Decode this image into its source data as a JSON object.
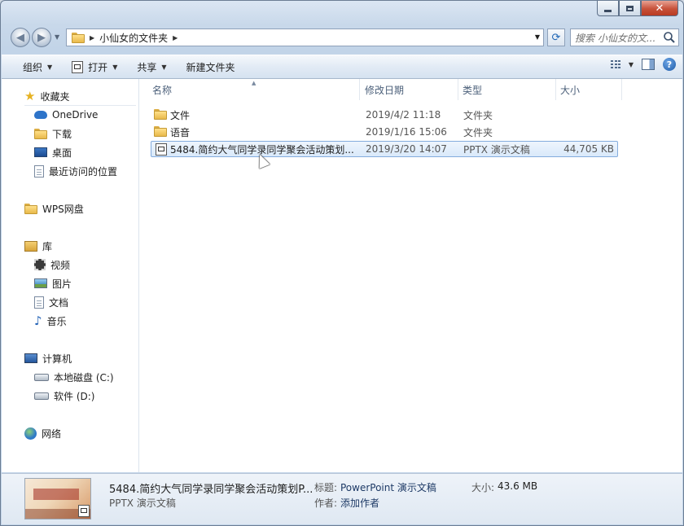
{
  "window": {
    "address_path": "小仙女的文件夹",
    "search_placeholder": "搜索 小仙女的文..."
  },
  "toolbar": {
    "organize": "组织",
    "open": "打开",
    "share": "共享",
    "new_folder": "新建文件夹"
  },
  "nav_pane": {
    "favorites": "收藏夹",
    "onedrive": "OneDrive",
    "downloads": "下载",
    "desktop": "桌面",
    "recent": "最近访问的位置",
    "wps": "WPS网盘",
    "libraries": "库",
    "videos": "视频",
    "pictures": "图片",
    "documents": "文档",
    "music": "音乐",
    "computer": "计算机",
    "local_disk": "本地磁盘 (C:)",
    "software": "软件 (D:)",
    "network": "网络"
  },
  "columns": {
    "name": "名称",
    "modified": "修改日期",
    "type": "类型",
    "size": "大小"
  },
  "files": [
    {
      "name": "文件",
      "modified": "2019/4/2 11:18",
      "type": "文件夹",
      "size": ""
    },
    {
      "name": "语音",
      "modified": "2019/1/16 15:06",
      "type": "文件夹",
      "size": ""
    },
    {
      "name": "5484.简约大气同学录同学聚会活动策划...",
      "modified": "2019/3/20 14:07",
      "type": "PPTX 演示文稿",
      "size": "44,705 KB"
    }
  ],
  "details": {
    "filename": "5484.简约大气同学录同学聚会活动策划P...",
    "filetype": "PPTX 演示文稿",
    "title_label": "标题:",
    "title_value": "PowerPoint 演示文稿",
    "author_label": "作者:",
    "author_value": "添加作者",
    "size_label": "大小:",
    "size_value": "43.6 MB"
  }
}
